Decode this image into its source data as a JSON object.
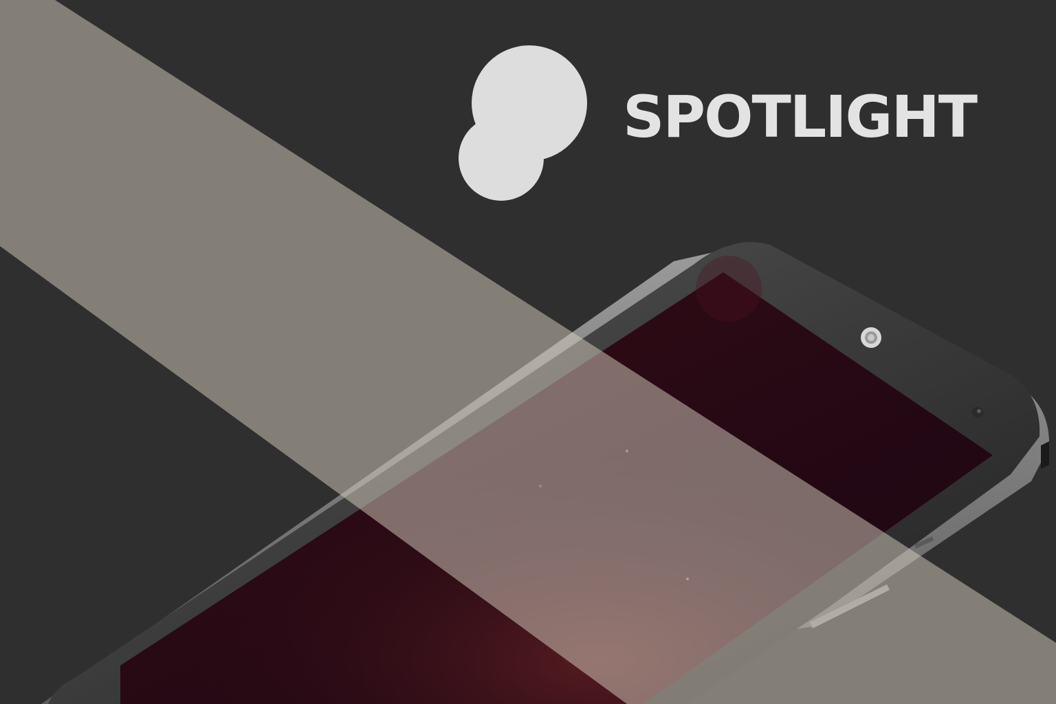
{
  "brand": {
    "name": "SPOTLIGHT",
    "logo_icon": "spotlight-logo-icon",
    "text_color": "#e3e3e3",
    "logo_color": "#dddddd"
  },
  "background_color": "#2f2f2f",
  "light_beam_color": "#d8d0c0",
  "device": {
    "icon": "smartphone-icon",
    "body_color": "#3a3a3a",
    "screen_color": "#2a0a14"
  }
}
